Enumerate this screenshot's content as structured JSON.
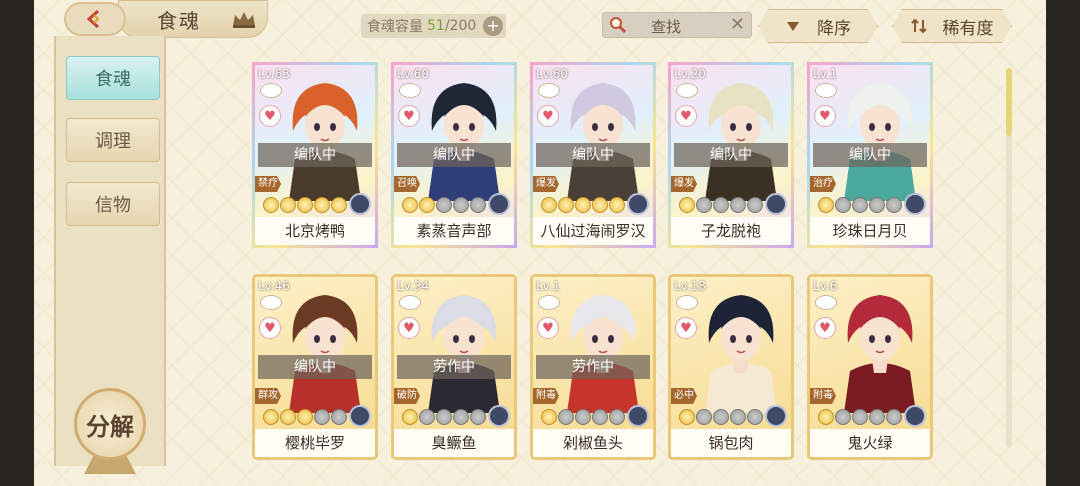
{
  "header": {
    "title": "食魂",
    "capacity_label": "食魂容量",
    "capacity_current": "51",
    "capacity_max": "/200",
    "plus_label": "+",
    "search_placeholder": "查找",
    "clear_label": "✕",
    "sort_order_label": "降序",
    "sort_by_label": "稀有度"
  },
  "sidebar": {
    "items": [
      {
        "label": "食魂",
        "active": true
      },
      {
        "label": "调理",
        "active": false
      },
      {
        "label": "信物",
        "active": false
      }
    ],
    "decompose_label": "分解"
  },
  "cards": [
    {
      "level": "Lv.63",
      "status": "编队中",
      "role": "禁疗",
      "stars_on": 5,
      "stars_off": 0,
      "name": "北京烤鸭",
      "rainbow": true,
      "hair": "#d8622a",
      "outfit": "#4a3a2c"
    },
    {
      "level": "Lv.60",
      "status": "编队中",
      "role": "召唤",
      "stars_on": 2,
      "stars_off": 3,
      "name": "素蒸音声部",
      "rainbow": true,
      "hair": "#1f2636",
      "outfit": "#2f3d78"
    },
    {
      "level": "Lv.60",
      "status": "编队中",
      "role": "爆发",
      "stars_on": 5,
      "stars_off": 0,
      "name": "八仙过海闹罗汉",
      "rainbow": true,
      "hair": "#cfcadf",
      "outfit": "#4a4038"
    },
    {
      "level": "Lv.20",
      "status": "编队中",
      "role": "爆发",
      "stars_on": 1,
      "stars_off": 4,
      "name": "子龙脱袍",
      "rainbow": true,
      "hair": "#e9e1c4",
      "outfit": "#3a3024"
    },
    {
      "level": "Lv.1",
      "status": "编队中",
      "role": "治疗",
      "stars_on": 1,
      "stars_off": 4,
      "name": "珍珠日月贝",
      "rainbow": true,
      "hair": "#eef2ee",
      "outfit": "#4aa89c"
    },
    {
      "level": "Lv.46",
      "status": "编队中",
      "role": "群攻",
      "stars_on": 3,
      "stars_off": 2,
      "name": "樱桃毕罗",
      "rainbow": false,
      "hair": "#6a3a22",
      "outfit": "#b8302a"
    },
    {
      "level": "Lv.34",
      "status": "劳作中",
      "role": "破防",
      "stars_on": 1,
      "stars_off": 4,
      "name": "臭鳜鱼",
      "rainbow": false,
      "hair": "#dcdce4",
      "outfit": "#2a2a34"
    },
    {
      "level": "Lv.1",
      "status": "劳作中",
      "role": "附毒",
      "stars_on": 1,
      "stars_off": 4,
      "name": "剁椒鱼头",
      "rainbow": false,
      "hair": "#e8e8ec",
      "outfit": "#c7342c"
    },
    {
      "level": "Lv.18",
      "status": "",
      "role": "必中",
      "stars_on": 1,
      "stars_off": 4,
      "name": "锅包肉",
      "rainbow": false,
      "hair": "#1e2436",
      "outfit": "#f4ead4"
    },
    {
      "level": "Lv.6",
      "status": "",
      "role": "附毒",
      "stars_on": 1,
      "stars_off": 4,
      "name": "鬼火绿",
      "rainbow": false,
      "hair": "#b32a3a",
      "outfit": "#7a1c22"
    }
  ],
  "colors": {
    "accent_gold": "#e9c87a",
    "active_teal": "#a8e0dc",
    "capacity_green": "#7ba23a"
  }
}
